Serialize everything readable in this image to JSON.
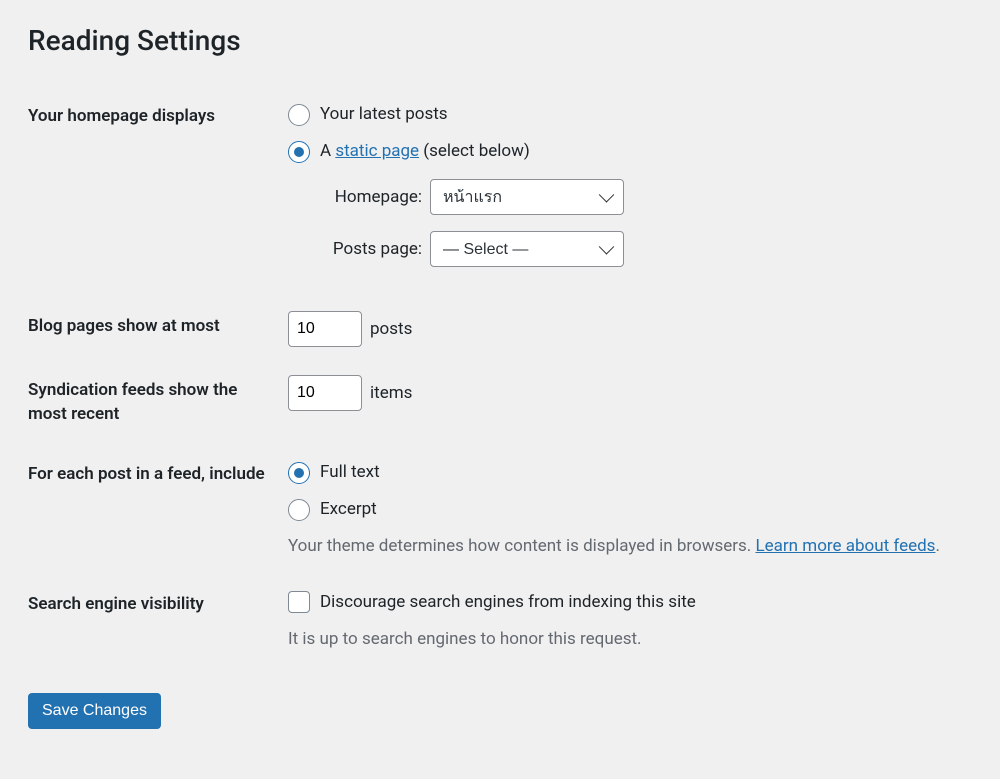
{
  "page": {
    "title": "Reading Settings"
  },
  "homepage": {
    "label": "Your homepage displays",
    "opt_latest": "Your latest posts",
    "opt_static_prefix": "A ",
    "opt_static_link": "static page",
    "opt_static_suffix": " (select below)",
    "homepage_label": "Homepage:",
    "homepage_selected": "หน้าแรก",
    "postspage_label": "Posts page:",
    "postspage_selected": "— Select —"
  },
  "blog_pages": {
    "label": "Blog pages show at most",
    "value": "10",
    "suffix": "posts"
  },
  "syndication": {
    "label": "Syndication feeds show the most recent",
    "value": "10",
    "suffix": "items"
  },
  "feed_include": {
    "label": "For each post in a feed, include",
    "opt_full": "Full text",
    "opt_excerpt": "Excerpt",
    "desc_prefix": "Your theme determines how content is displayed in browsers. ",
    "desc_link": "Learn more about feeds",
    "desc_suffix": "."
  },
  "sev": {
    "label": "Search engine visibility",
    "check": "Discourage search engines from indexing this site",
    "desc": "It is up to search engines to honor this request."
  },
  "submit": {
    "save": "Save Changes"
  }
}
